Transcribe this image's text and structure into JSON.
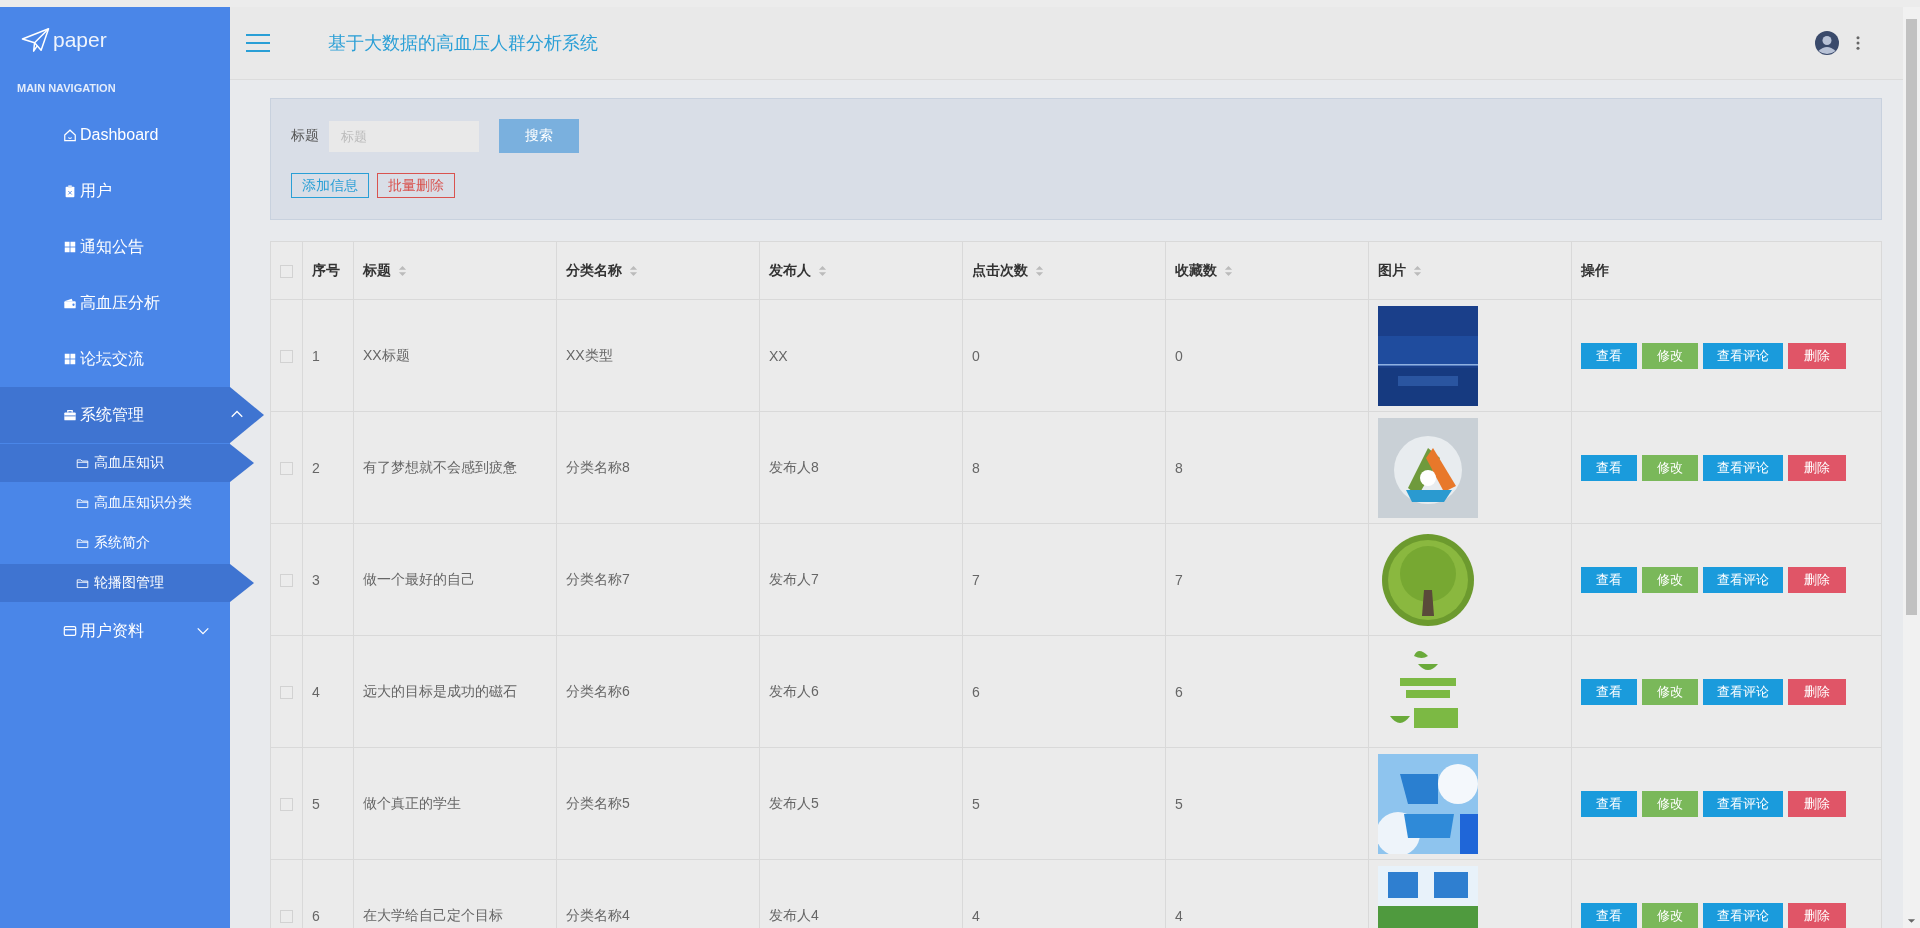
{
  "sidebar": {
    "logo": "paper",
    "section_title": "MAIN NAVIGATION",
    "items": [
      {
        "label": "Dashboard",
        "selected": false
      },
      {
        "label": "用户",
        "selected": false
      },
      {
        "label": "通知公告",
        "selected": false
      },
      {
        "label": "高血压分析",
        "selected": false
      },
      {
        "label": "论坛交流",
        "selected": false
      },
      {
        "label": "系统管理",
        "selected": true,
        "expanded": true,
        "children": [
          {
            "label": "高血压知识",
            "selected": true
          },
          {
            "label": "高血压知识分类",
            "selected": false
          },
          {
            "label": "系统简介",
            "selected": false
          },
          {
            "label": "轮播图管理",
            "selected": true
          }
        ]
      },
      {
        "label": "用户资料",
        "selected": false,
        "expanded": false
      }
    ]
  },
  "header": {
    "title": "基于大数据的高血压人群分析系统"
  },
  "search": {
    "label": "标题",
    "placeholder": "标题",
    "button": "搜索"
  },
  "toolbar": [
    {
      "label": "添加信息",
      "kind": "add"
    },
    {
      "label": "批量删除",
      "kind": "delete"
    }
  ],
  "table": {
    "select_all_checked": false,
    "columns": [
      {
        "label": "序号",
        "sortable": false
      },
      {
        "label": "标题",
        "sortable": true
      },
      {
        "label": "分类名称",
        "sortable": true
      },
      {
        "label": "发布人",
        "sortable": true
      },
      {
        "label": "点击次数",
        "sortable": true
      },
      {
        "label": "收藏数",
        "sortable": true
      },
      {
        "label": "图片",
        "sortable": true
      },
      {
        "label": "操作",
        "sortable": false
      }
    ],
    "rows": [
      {
        "checked": false,
        "cells": [
          "1",
          "XX标题",
          "XX类型",
          "XX",
          "0",
          "0"
        ],
        "actions": [
          {
            "label": "查看",
            "kind": "primary"
          },
          {
            "label": "修改",
            "kind": "success"
          },
          {
            "label": "查看评论",
            "kind": "primary"
          },
          {
            "label": "删除",
            "kind": "danger"
          }
        ]
      },
      {
        "checked": false,
        "cells": [
          "2",
          "有了梦想就不会感到疲惫",
          "分类名称8",
          "发布人8",
          "8",
          "8"
        ],
        "actions": [
          {
            "label": "查看",
            "kind": "primary"
          },
          {
            "label": "修改",
            "kind": "success"
          },
          {
            "label": "查看评论",
            "kind": "primary"
          },
          {
            "label": "删除",
            "kind": "danger"
          }
        ]
      },
      {
        "checked": false,
        "cells": [
          "3",
          "做一个最好的自己",
          "分类名称7",
          "发布人7",
          "7",
          "7"
        ],
        "actions": [
          {
            "label": "查看",
            "kind": "primary"
          },
          {
            "label": "修改",
            "kind": "success"
          },
          {
            "label": "查看评论",
            "kind": "primary"
          },
          {
            "label": "删除",
            "kind": "danger"
          }
        ]
      },
      {
        "checked": false,
        "cells": [
          "4",
          "远大的目标是成功的磁石",
          "分类名称6",
          "发布人6",
          "6",
          "6"
        ],
        "actions": [
          {
            "label": "查看",
            "kind": "primary"
          },
          {
            "label": "修改",
            "kind": "success"
          },
          {
            "label": "查看评论",
            "kind": "primary"
          },
          {
            "label": "删除",
            "kind": "danger"
          }
        ]
      },
      {
        "checked": false,
        "cells": [
          "5",
          "做个真正的学生",
          "分类名称5",
          "发布人5",
          "5",
          "5"
        ],
        "actions": [
          {
            "label": "查看",
            "kind": "primary"
          },
          {
            "label": "修改",
            "kind": "success"
          },
          {
            "label": "查看评论",
            "kind": "primary"
          },
          {
            "label": "删除",
            "kind": "danger"
          }
        ]
      },
      {
        "checked": false,
        "cells": [
          "6",
          "在大学给自己定个目标",
          "分类名称4",
          "发布人4",
          "4",
          "4"
        ],
        "actions": [
          {
            "label": "查看",
            "kind": "primary"
          },
          {
            "label": "修改",
            "kind": "success"
          },
          {
            "label": "查看评论",
            "kind": "primary"
          },
          {
            "label": "删除",
            "kind": "danger"
          }
        ]
      }
    ]
  }
}
